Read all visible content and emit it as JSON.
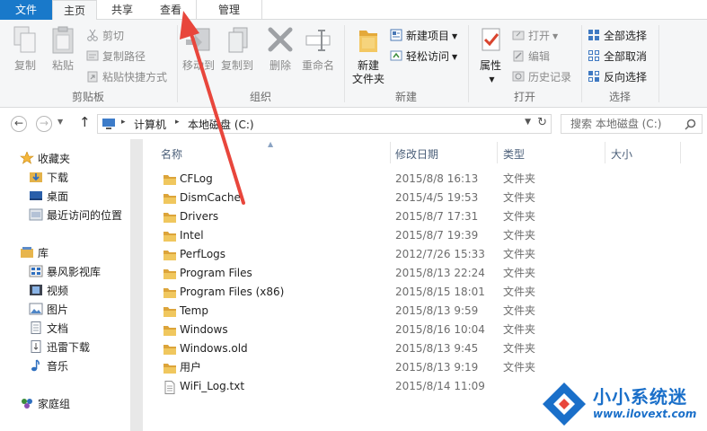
{
  "tabs": {
    "file": "文件",
    "home": "主页",
    "share": "共享",
    "view": "查看",
    "manage": "管理"
  },
  "ribbon": {
    "clipboard": {
      "label": "剪贴板",
      "copy": "复制",
      "paste": "粘贴",
      "cut": "剪切",
      "copy_path": "复制路径",
      "paste_shortcut": "粘贴快捷方式"
    },
    "organize": {
      "label": "组织",
      "move_to": "移动到",
      "copy_to": "复制到",
      "delete": "删除",
      "rename": "重命名"
    },
    "new": {
      "label": "新建",
      "new_folder_line1": "新建",
      "new_folder_line2": "文件夹",
      "new_item": "新建项目",
      "easy_access": "轻松访问"
    },
    "open": {
      "label": "打开",
      "properties": "属性",
      "open": "打开",
      "edit": "编辑",
      "history": "历史记录"
    },
    "select": {
      "label": "选择",
      "select_all": "全部选择",
      "select_none": "全部取消",
      "invert": "反向选择"
    }
  },
  "address": {
    "crumbs": [
      "计算机",
      "本地磁盘 (C:)"
    ],
    "search_placeholder": "搜索 本地磁盘 (C:)"
  },
  "navpane": {
    "favorites": "收藏夹",
    "downloads": "下载",
    "desktop": "桌面",
    "recent": "最近访问的位置",
    "libraries": "库",
    "baofeng": "暴风影视库",
    "videos": "视频",
    "pictures": "图片",
    "documents": "文档",
    "xunlei": "迅雷下载",
    "music": "音乐",
    "homegroup": "家庭组"
  },
  "columns": {
    "name": "名称",
    "date": "修改日期",
    "type": "类型",
    "size": "大小"
  },
  "files": [
    {
      "name": "CFLog",
      "date": "2015/8/8 16:13",
      "type": "文件夹",
      "kind": "folder"
    },
    {
      "name": "DismCache",
      "date": "2015/4/5 19:53",
      "type": "文件夹",
      "kind": "folder"
    },
    {
      "name": "Drivers",
      "date": "2015/8/7 17:31",
      "type": "文件夹",
      "kind": "folder"
    },
    {
      "name": "Intel",
      "date": "2015/8/7 19:39",
      "type": "文件夹",
      "kind": "folder"
    },
    {
      "name": "PerfLogs",
      "date": "2012/7/26 15:33",
      "type": "文件夹",
      "kind": "folder"
    },
    {
      "name": "Program Files",
      "date": "2015/8/13 22:24",
      "type": "文件夹",
      "kind": "folder"
    },
    {
      "name": "Program Files (x86)",
      "date": "2015/8/15 18:01",
      "type": "文件夹",
      "kind": "folder"
    },
    {
      "name": "Temp",
      "date": "2015/8/13 9:59",
      "type": "文件夹",
      "kind": "folder"
    },
    {
      "name": "Windows",
      "date": "2015/8/16 10:04",
      "type": "文件夹",
      "kind": "folder"
    },
    {
      "name": "Windows.old",
      "date": "2015/8/13 9:45",
      "type": "文件夹",
      "kind": "folder"
    },
    {
      "name": "用户",
      "date": "2015/8/13 9:19",
      "type": "文件夹",
      "kind": "folder"
    },
    {
      "name": "WiFi_Log.txt",
      "date": "2015/8/14 11:09",
      "type": "",
      "kind": "text-file"
    }
  ],
  "watermark": {
    "title": "小小系统迷",
    "url": "www.ilovext.com"
  },
  "colors": {
    "file_tab": "#1979ca",
    "folder": "#e8b84a",
    "arrow": "#e8463c",
    "watermark": "#1a6fc9"
  }
}
